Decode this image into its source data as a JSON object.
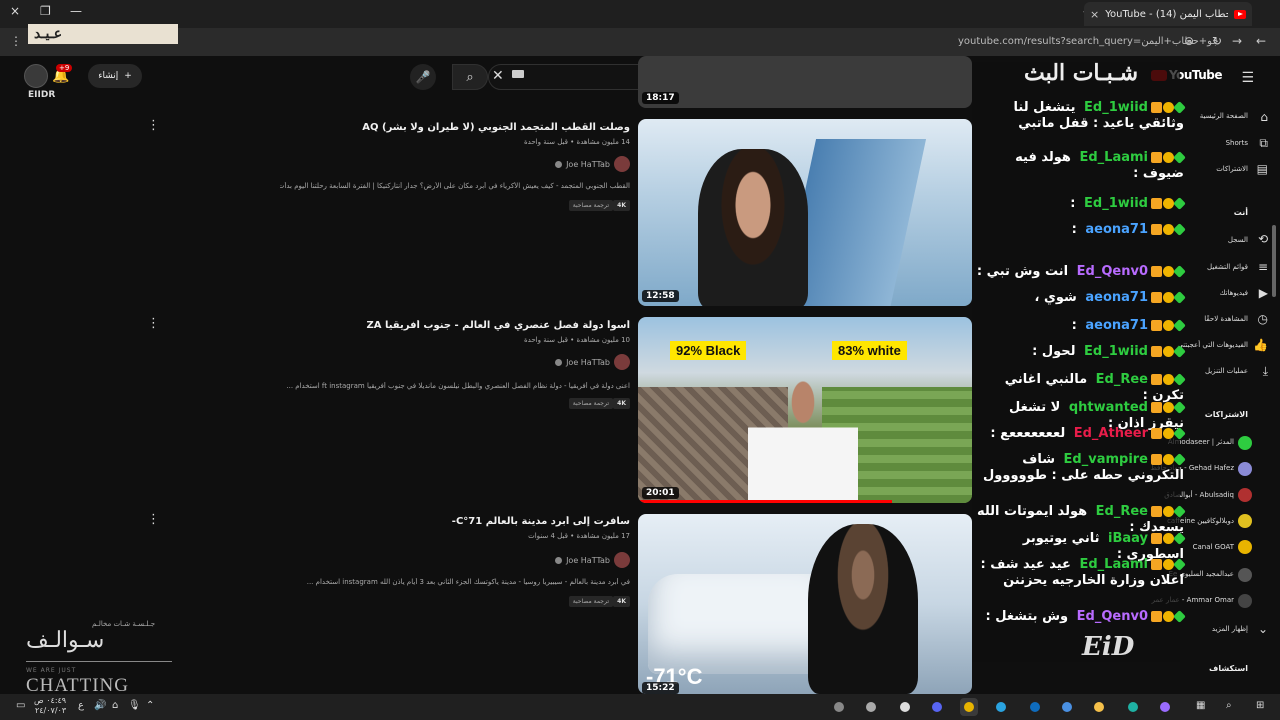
{
  "browser": {
    "tab_title": "YouTube - جو حطاب اليمن (14)",
    "url": "youtube.com/results?search_query=جو+حطاب+اليمن",
    "window_controls": [
      "×",
      "❐",
      "—"
    ],
    "new_tab": "+",
    "tab_close": "×"
  },
  "overlay_logo": "عـيـد",
  "youtube": {
    "search_query": "جو حطاب اليمن",
    "create_label": "إنشاء",
    "notif_count": "+9",
    "channel_tag": "EIIDR",
    "logo_text": "YouTube"
  },
  "results": [
    {
      "title": "وصلت القطب المتجمد الجنوبي (لا طيران ولا بشر) AQ",
      "meta": "14 مليون مشاهدة • قبل سنة واحدة",
      "channel": "Joe HaTTab",
      "desc": "القطب الجنوبي المتجمد - كيف يعيش الأكرياء في أبرد مكان على الأرض؟ جدار أنتاركتيكا | الفترة السابعة رحلتنا اليوم بدأت من كيب ...",
      "quality": "4K",
      "tag": "ترجمة مصاحبة",
      "duration": "12:58"
    },
    {
      "title": "أسوأ دولة فصل عنصري في العالم - جنوب أفريقيا ZA",
      "meta": "10 مليون مشاهدة • قبل سنة واحدة",
      "channel": "Joe HaTTab",
      "desc": "اعنى دولة في أفريقيا - دولة نظام الفصل العنصري والبطل نيلسون مانديلا في جنوب أفريقيا ft instagram استخدام ...",
      "quality": "4K",
      "tag": "ترجمة مصاحبة",
      "duration": "20:01",
      "label_left": "92% Black",
      "label_right": "83% white"
    },
    {
      "title": "سافرت إلى أبرد مدينة بالعالم 71°C-",
      "meta": "17 مليون مشاهدة • قبل 4 سنوات",
      "channel": "Joe HaTTab",
      "desc": "في أبرد مدينة بالعالم - سيبيريا روسيا - مدينة ياكوتسك الجزء الثاني بعد 3 أيام يأذن الله instagram استخدام ...",
      "quality": "4K",
      "tag": "ترجمة مصاحبة",
      "duration": "15:22",
      "temp_label": "-71°C"
    }
  ],
  "top_duration": "18:17",
  "chat": {
    "title": "شـبـات البث",
    "messages": [
      {
        "user": "Ed_1wiid",
        "text": "يتشغل لنا وثائقي ياعيد : قفل ماتبي",
        "color": "#2ecc40"
      },
      {
        "user": "Ed_Laami",
        "text": "هولد فيه ضيوف :",
        "color": "#2ecc40"
      },
      {
        "user": "Ed_1wiid",
        "text": ":",
        "color": "#2ecc40"
      },
      {
        "user": "aeona71",
        "text": ":",
        "color": "#4aa3ff"
      },
      {
        "user": "Ed_Qenv0",
        "text": "انت وش تبي :",
        "color": "#b86bff"
      },
      {
        "user": "aeona71",
        "text": "شوي ،",
        "color": "#4aa3ff"
      },
      {
        "user": "aeona71",
        "text": ":",
        "color": "#4aa3ff"
      },
      {
        "user": "Ed_1wiid",
        "text": "لحول :",
        "color": "#2ecc40"
      },
      {
        "user": "Ed_Ree",
        "text": "مالنبي اغاني تكرن :",
        "color": "#2ecc40"
      },
      {
        "user": "qhtwanted",
        "text": "لا تشغل نيقرز اذان :",
        "color": "#2ecc40"
      },
      {
        "user": "Ed_Atheer",
        "text": "لعععععععع :",
        "color": "#e81d4a"
      },
      {
        "user": "Ed_vampire",
        "text": "شاف التكروني حطه على : طووووول",
        "color": "#2ecc40"
      },
      {
        "user": "Ed_Ree",
        "text": "هولد ايموتات الله يسعدك :",
        "color": "#2ecc40"
      },
      {
        "user": "iBaay",
        "text": "ثاني يوتيوبر اسطوري :",
        "color": "#2ecc40"
      },
      {
        "user": "Ed_Laami",
        "text": "عيد عيد شف : اعلان وزارة الخارجيه يحزننن",
        "color": "#2ecc40"
      },
      {
        "user": "Ed_Qenv0",
        "text": "وش بتشغل :",
        "color": "#b86bff"
      }
    ],
    "logo": "EiD"
  },
  "sidebar": {
    "items": [
      "الصفحة الرئيسية",
      "Shorts",
      "الاشتراكات"
    ],
    "you_head": "أنت",
    "you_items": [
      "السجل",
      "قوائم التشغيل",
      "فيديوهاتك",
      "المشاهدة لاحقًا",
      "الفيديوهات التي أعجبتني",
      "عمليات التنزيل"
    ],
    "subs_head": "الاشتراكات",
    "subs": [
      "المدثر | Almodaseer",
      "Gehad Hafez - جهاد حافظ",
      "Abulsadiq - أبوالصادق",
      "دوبلالوكافيين caffeine",
      "Canal GOAT",
      "عبدالمجيد السليوي Ee",
      "Ammar Omar - عمار عمر"
    ],
    "show_more": "إظهار المزيد",
    "explore": "استكشاف"
  },
  "overlay_bottom": {
    "small": "جـلـسـة شـات مخالـم",
    "big": "سـوالـف",
    "tiny": "WE ARE JUST",
    "chat": "CHATTING"
  },
  "taskbar": {
    "time": "٠٤:٤٩ ص",
    "date": "٢٤/٠٧/٠٣",
    "lang": "ع"
  }
}
